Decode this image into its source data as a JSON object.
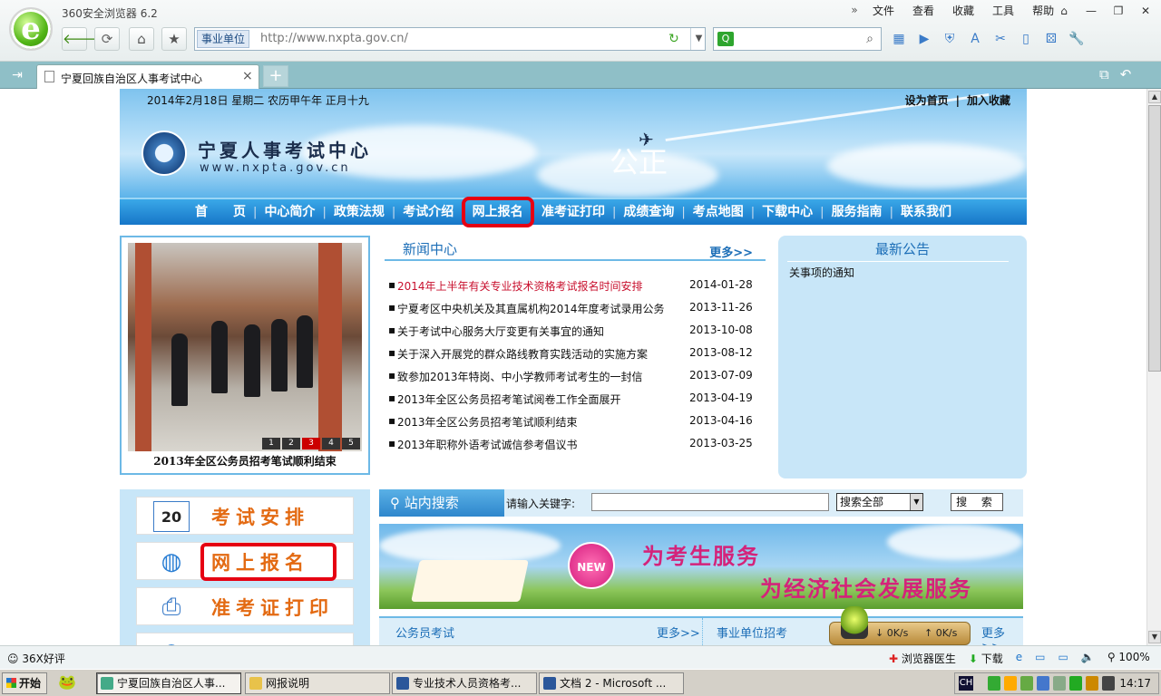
{
  "browser": {
    "app_title": "360安全浏览器 6.2",
    "menu_chevron": "»",
    "menu": [
      "文件",
      "查看",
      "收藏",
      "工具",
      "帮助"
    ],
    "address_tag": "事业单位",
    "url": "http://www.nxpta.gov.cn/",
    "tab_title": "宁夏回族自治区人事考试中心",
    "new_tab": "+"
  },
  "page": {
    "date_line": "2014年2月18日 星期二 农历甲午年 正月十九",
    "set_home": "设为首页",
    "link_sep": "|",
    "add_fav": "加入收藏",
    "site_name": "宁夏人事考试中心",
    "site_url": "www.nxpta.gov.cn",
    "slogan": "公正",
    "nav": [
      "首　　页",
      "中心简介",
      "政策法规",
      "考试介绍",
      "网上报名",
      "准考证打印",
      "成绩查询",
      "考点地图",
      "下载中心",
      "服务指南",
      "联系我们"
    ],
    "nav_sep": "|",
    "photo_caption": "2013年全区公务员招考笔试顺利结束",
    "photo_pages": [
      "1",
      "2",
      "3",
      "4",
      "5"
    ],
    "photo_active_page": 3,
    "news_title": "新闻中心",
    "news_more": "更多>>",
    "news_bullet": "▪",
    "news": [
      {
        "title": "2014年上半年有关专业技术资格考试报名时间安排",
        "date": "2014-01-28"
      },
      {
        "title": "宁夏考区中央机关及其直属机构2014年度考试录用公务",
        "date": "2013-11-26"
      },
      {
        "title": "关于考试中心服务大厅变更有关事宜的通知",
        "date": "2013-10-08"
      },
      {
        "title": "关于深入开展党的群众路线教育实践活动的实施方案",
        "date": "2013-08-12"
      },
      {
        "title": "致参加2013年特岗、中小学教师考试考生的一封信",
        "date": "2013-07-09"
      },
      {
        "title": "2013年全区公务员招考笔试阅卷工作全面展开",
        "date": "2013-04-19"
      },
      {
        "title": "2013年全区公务员招考笔试顺利结束",
        "date": "2013-04-16"
      },
      {
        "title": "2013年职称外语考试诚信参考倡议书",
        "date": "2013-03-25"
      }
    ],
    "news_highlight_color": "#c8102e",
    "notice_title": "最新公告",
    "notice_item": "关事项的通知",
    "quick": [
      {
        "label": "考试安排",
        "icon": "calendar-icon",
        "glyph": "20"
      },
      {
        "label": "网上报名",
        "icon": "globe-icon",
        "glyph": "◍"
      },
      {
        "label": "准考证打印",
        "icon": "printer-icon",
        "glyph": "⎙"
      }
    ],
    "search_label": "站内搜索",
    "search_kw_label": "请输入关键字:",
    "search_scope": "搜索全部",
    "search_button": "搜 索",
    "banner_new": "NEW",
    "banner_line1": "为考生服务",
    "banner_line2": "为经济社会发展服务",
    "tab_civil": "公务员考试",
    "tab_civil_more": "更多>>",
    "tab_inst": "事业单位招考",
    "tab_inst_more": "更多>>",
    "highlight_color": "#e60012"
  },
  "speed": {
    "down": "0K/s",
    "up": "0K/s"
  },
  "status": {
    "rating": "36X好评",
    "doctor": "浏览器医生",
    "download": "下载",
    "zoom": "100%"
  },
  "taskbar": {
    "start": "开始",
    "tasks": [
      "宁夏回族自治区人事...",
      "网报说明",
      "专业技术人员资格考...",
      "文档 2 - Microsoft ..."
    ],
    "ime": "CH",
    "time": "14:17"
  }
}
